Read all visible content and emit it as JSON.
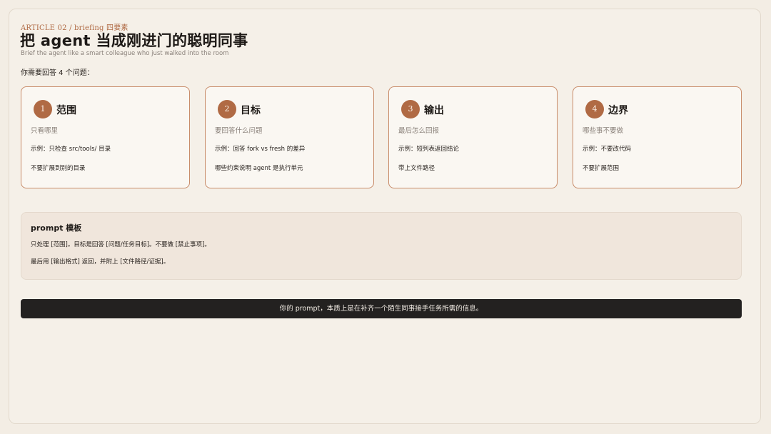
{
  "header": {
    "kicker": "ARTICLE 02 / briefing 四要素",
    "title": "把 agent 当成刚进门的聪明同事",
    "subtitle": "Brief the agent like a smart colleague who just walked into the room",
    "intro": "你需要回答 4 个问题："
  },
  "cards": [
    {
      "number": "1",
      "title": "范围",
      "subtitle": "只看哪里",
      "example": "示例：只检查 src/tools/ 目录",
      "note": "不要扩展到别的目录"
    },
    {
      "number": "2",
      "title": "目标",
      "subtitle": "要回答什么问题",
      "example": "示例：回答 fork vs fresh 的差异",
      "note": "哪些约束说明 agent 是执行单元"
    },
    {
      "number": "3",
      "title": "输出",
      "subtitle": "最后怎么回报",
      "example": "示例：短列表返回结论",
      "note": "带上文件路径"
    },
    {
      "number": "4",
      "title": "边界",
      "subtitle": "哪些事不要做",
      "example": "示例：不要改代码",
      "note": "不要扩展范围"
    }
  ],
  "template": {
    "title": "prompt 模板",
    "line1": "只处理 [范围]。目标是回答 [问题/任务目标]。不要做 [禁止事项]。",
    "line2": "最后用 [输出格式] 返回，并附上 [文件路径/证据]。"
  },
  "footer": {
    "text": "你的 prompt，本质上是在补齐一个陌生同事接手任务所需的信息。"
  },
  "colors": {
    "accent": "#b06a44",
    "card_border": "#c88c6a",
    "background": "#f3ede4",
    "footer_bg": "#232120"
  }
}
